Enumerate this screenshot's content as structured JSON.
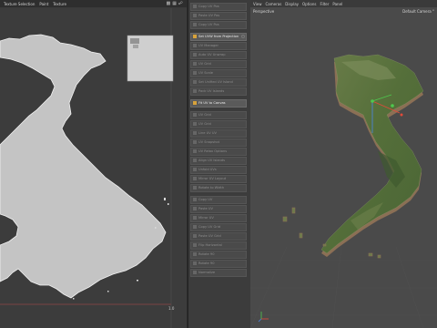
{
  "uv_editor": {
    "menu": [
      "Texture Selection",
      "Paint",
      "Texture"
    ],
    "axis_label": "1.0"
  },
  "tools_panel": {
    "items": [
      {
        "label": "Copy UV Pos",
        "active": false
      },
      {
        "label": "Paste UV Pos",
        "active": false
      },
      {
        "label": "Copy UV Pos",
        "active": false
      },
      {
        "label": "Set UVW from Projection",
        "active": true,
        "closable": true
      },
      {
        "label": "UV Manager",
        "active": false
      },
      {
        "label": "Auto UV Unwrap",
        "active": false
      },
      {
        "label": "UV Grid",
        "active": false
      },
      {
        "label": "UV Scale",
        "active": false
      },
      {
        "label": "Set Unified UV Island",
        "active": false
      },
      {
        "label": "Pack UV Islands",
        "active": false
      },
      {
        "label": "Fit UV to Canvas",
        "active": true
      },
      {
        "label": "UV Grid",
        "active": false
      },
      {
        "label": "UV Grid",
        "active": false
      },
      {
        "label": "Line UV UV",
        "active": false
      },
      {
        "label": "UV Snapshot",
        "active": false
      },
      {
        "label": "UV Relax Options",
        "active": false
      },
      {
        "label": "Align UV Islands",
        "active": false
      },
      {
        "label": "Unfold UVs",
        "active": false
      },
      {
        "label": "Mirror UV Layout",
        "active": false
      },
      {
        "label": "Rotate to Width",
        "active": false
      },
      {
        "label": "Copy UV",
        "active": false
      },
      {
        "label": "Paste UV",
        "active": false
      },
      {
        "label": "Mirror UV",
        "active": false
      },
      {
        "label": "Copy UV Grid",
        "active": false
      },
      {
        "label": "Paste UV Grid",
        "active": false
      },
      {
        "label": "Flip Horizontal",
        "active": false
      },
      {
        "label": "Rotate 90",
        "active": false
      },
      {
        "label": "Rotate 90",
        "active": false
      },
      {
        "label": "Normalize",
        "active": false
      }
    ]
  },
  "viewport": {
    "menu": [
      "View",
      "Cameras",
      "Display",
      "Options",
      "Filter",
      "Panel"
    ],
    "view_name": "Perspective",
    "camera": "Default Camera °"
  },
  "colors": {
    "uv_bg": "#3a3a3a",
    "map_fill": "#c4c4c4",
    "map_stroke": "#f0f0f0",
    "viewport_bg": "#4a4a4a",
    "axis_x": "#e24a3a",
    "axis_y": "#4ec94e",
    "axis_z": "#4a86e8"
  }
}
